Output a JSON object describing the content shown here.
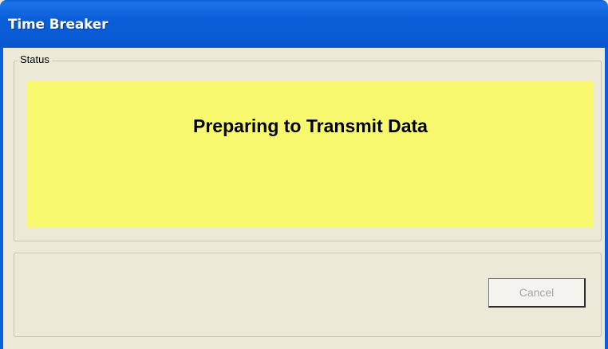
{
  "window": {
    "title": "Time Breaker"
  },
  "status_group": {
    "label": "Status",
    "message": "Preparing to Transmit Data",
    "background_color": "#f8f86e"
  },
  "actions": {
    "cancel_label": "Cancel",
    "cancel_enabled": false
  },
  "colors": {
    "titlebar": "#0b5ed9",
    "dialog_background": "#ece9d8"
  }
}
